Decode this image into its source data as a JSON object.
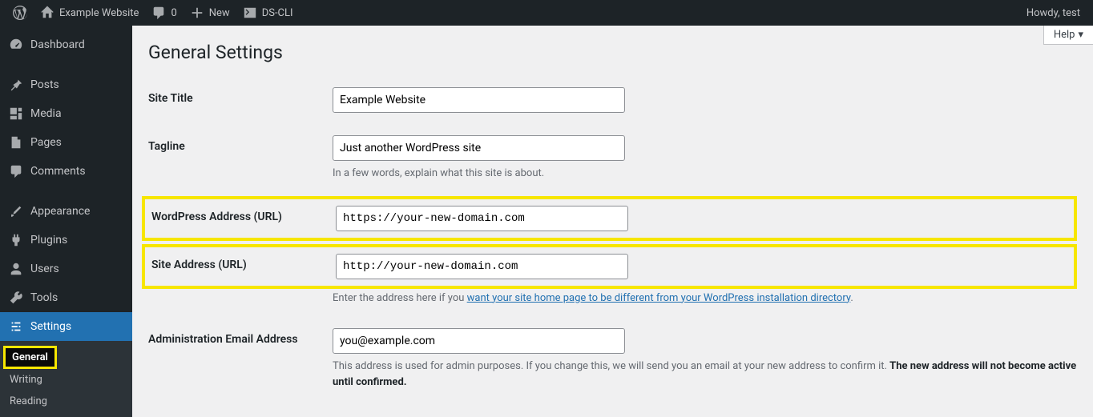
{
  "adminbar": {
    "site_name": "Example Website",
    "comments_count": "0",
    "new_label": "New",
    "dscli_label": "DS-CLI",
    "howdy": "Howdy, test"
  },
  "sidebar": {
    "dashboard_label": "Dashboard",
    "posts_label": "Posts",
    "media_label": "Media",
    "pages_label": "Pages",
    "comments_label": "Comments",
    "appearance_label": "Appearance",
    "plugins_label": "Plugins",
    "users_label": "Users",
    "tools_label": "Tools",
    "settings_label": "Settings",
    "submenu": {
      "general": "General",
      "writing": "Writing",
      "reading": "Reading"
    }
  },
  "help_label": "Help",
  "page_title": "General Settings",
  "fields": {
    "site_title_label": "Site Title",
    "site_title_value": "Example Website",
    "tagline_label": "Tagline",
    "tagline_value": "Just another WordPress site",
    "tagline_desc": "In a few words, explain what this site is about.",
    "wpurl_label": "WordPress Address (URL)",
    "wpurl_value": "https://your-new-domain.com",
    "siteurl_label": "Site Address (URL)",
    "siteurl_value": "http://your-new-domain.com",
    "siteurl_desc_pre": "Enter the address here if you ",
    "siteurl_desc_link": "want your site home page to be different from your WordPress installation directory",
    "siteurl_desc_post": ".",
    "adminemail_label": "Administration Email Address",
    "adminemail_value": "you@example.com",
    "adminemail_desc_1": "This address is used for admin purposes. If you change this, we will send you an email at your new address to confirm it. ",
    "adminemail_desc_2": "The new address will not become active until confirmed."
  }
}
